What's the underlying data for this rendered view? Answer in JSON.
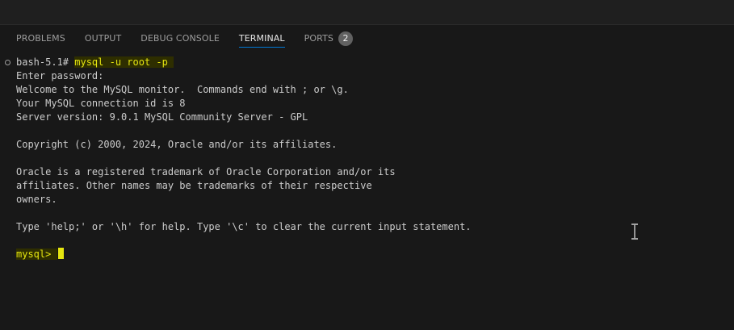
{
  "panel": {
    "tabs": [
      {
        "label": "PROBLEMS"
      },
      {
        "label": "OUTPUT"
      },
      {
        "label": "DEBUG CONSOLE"
      },
      {
        "label": "TERMINAL"
      },
      {
        "label": "PORTS",
        "badge": "2"
      }
    ],
    "active_tab": "TERMINAL"
  },
  "terminal": {
    "prompt_prefix": "bash-5.1# ",
    "command": "mysql -u root -p ",
    "lines": [
      "Enter password:",
      "Welcome to the MySQL monitor.  Commands end with ; or \\g.",
      "Your MySQL connection id is 8",
      "Server version: 9.0.1 MySQL Community Server - GPL",
      "",
      "Copyright (c) 2000, 2024, Oracle and/or its affiliates.",
      "",
      "Oracle is a registered trademark of Oracle Corporation and/or its",
      "affiliates. Other names may be trademarks of their respective",
      "owners.",
      "",
      "Type 'help;' or '\\h' for help. Type '\\c' to clear the current input statement.",
      ""
    ],
    "mysql_prompt": "mysql> "
  },
  "colors": {
    "background": "#181818",
    "text": "#cccccc",
    "highlight": "#e5e510",
    "active_tab_underline": "#0078d4"
  },
  "icons": {
    "decoration": "circle-outline-icon",
    "cursor": "text-ibeam-cursor-icon"
  }
}
